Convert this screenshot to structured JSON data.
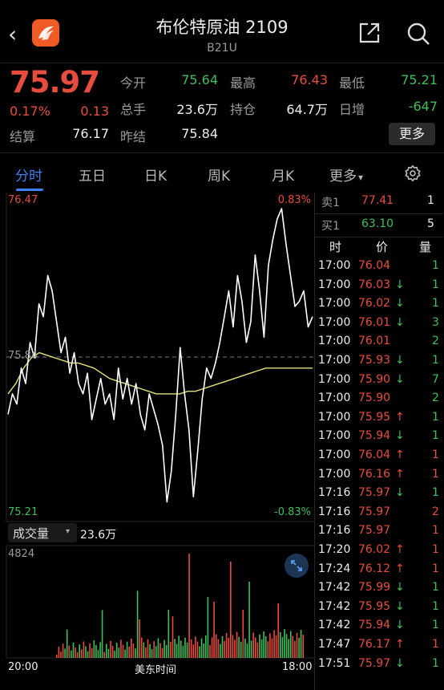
{
  "header": {
    "back_label": "‹",
    "title": "布伦特原油 2109",
    "subtitle": "B21U",
    "icons": [
      "back-icon",
      "app-logo-icon",
      "share-icon",
      "search-icon"
    ]
  },
  "quote": {
    "last_price": "75.97",
    "change_pct": "0.17%",
    "change": "0.13",
    "settlement_label": "结算",
    "settlement": "76.17",
    "stats": [
      {
        "label": "今开",
        "value": "75.64",
        "color": "green"
      },
      {
        "label": "最高",
        "value": "76.43",
        "color": "red"
      },
      {
        "label": "最低",
        "value": "75.21",
        "color": "green"
      },
      {
        "label": "总手",
        "value": "23.6万",
        "color": "white"
      },
      {
        "label": "持仓",
        "value": "64.7万",
        "color": "white"
      },
      {
        "label": "日增",
        "value": "-647",
        "color": "green"
      },
      {
        "label": "昨结",
        "value": "75.84",
        "color": "white"
      }
    ],
    "more_button": "更多"
  },
  "tabs": {
    "items": [
      "分时",
      "五日",
      "日K",
      "周K",
      "月K",
      "更多"
    ],
    "active": "分时",
    "more_caret": "▾",
    "settings_icon": "gear-icon"
  },
  "chart": {
    "top_price": "76.47",
    "top_pct": "0.83%",
    "mid_price": "75.84",
    "bottom_price": "75.21",
    "bottom_pct": "-0.83%",
    "volume_selector": "成交量",
    "volume_caret": "▾",
    "volume_total": "23.6万",
    "volume_max": "4824",
    "time_start": "20:00",
    "time_mid": "美东时间",
    "time_end": "18:00",
    "colors": {
      "up": "#e84c3d",
      "down": "#3fbf5a",
      "price_line": "#ffffff",
      "avg_line": "#e6e07a"
    }
  },
  "chart_data": {
    "type": "line",
    "price_series": [
      75.62,
      75.7,
      75.66,
      75.8,
      75.74,
      75.9,
      75.84,
      76.05,
      76.0,
      76.16,
      76.1,
      75.98,
      75.86,
      75.92,
      75.78,
      75.86,
      75.74,
      75.7,
      75.78,
      75.6,
      75.68,
      75.76,
      75.66,
      75.7,
      75.6,
      75.8,
      75.68,
      75.76,
      75.66,
      75.74,
      75.62,
      75.56,
      75.7,
      75.64,
      75.58,
      75.5,
      75.28,
      75.4,
      75.62,
      75.88,
      75.7,
      75.56,
      75.3,
      75.48,
      75.68,
      75.8,
      75.76,
      75.82,
      75.9,
      76.0,
      76.1,
      75.96,
      76.16,
      76.06,
      75.9,
      75.98,
      76.24,
      76.1,
      75.92,
      76.2,
      76.3,
      76.38,
      76.42,
      76.28,
      76.16,
      76.04,
      76.06,
      76.1,
      75.96,
      76.0
    ],
    "avg_series": [
      75.7,
      75.74,
      75.8,
      75.84,
      75.86,
      75.85,
      75.84,
      75.83,
      75.82,
      75.82,
      75.81,
      75.8,
      75.78,
      75.76,
      75.75,
      75.74,
      75.73,
      75.72,
      75.71,
      75.7,
      75.7,
      75.7,
      75.7,
      75.71,
      75.71,
      75.72,
      75.73,
      75.74,
      75.75,
      75.76,
      75.77,
      75.78,
      75.79,
      75.8,
      75.8,
      75.8,
      75.8,
      75.8,
      75.8,
      75.8
    ],
    "ylim": [
      75.21,
      76.47
    ],
    "reference": 75.84,
    "volume_max": 4824,
    "x_start": "20:00",
    "x_end": "18:00"
  },
  "right_panel": {
    "ask": {
      "label": "卖1",
      "price": "77.41",
      "qty": "1"
    },
    "bid": {
      "label": "买1",
      "price": "63.10",
      "qty": "5"
    },
    "headers": [
      "时",
      "价",
      "量"
    ],
    "ticks": [
      {
        "time": "17:00",
        "price": "76.04",
        "arrow": "",
        "qty": "1",
        "color": "red",
        "qcolor": "green"
      },
      {
        "time": "17:00",
        "price": "76.03",
        "arrow": "↓",
        "qty": "1",
        "color": "red",
        "qcolor": "green"
      },
      {
        "time": "17:00",
        "price": "76.02",
        "arrow": "↓",
        "qty": "1",
        "color": "red",
        "qcolor": "green"
      },
      {
        "time": "17:00",
        "price": "76.01",
        "arrow": "↓",
        "qty": "3",
        "color": "red",
        "qcolor": "green"
      },
      {
        "time": "17:00",
        "price": "76.01",
        "arrow": "",
        "qty": "2",
        "color": "red",
        "qcolor": "green"
      },
      {
        "time": "17:00",
        "price": "75.93",
        "arrow": "↓",
        "qty": "1",
        "color": "red",
        "qcolor": "green"
      },
      {
        "time": "17:00",
        "price": "75.90",
        "arrow": "↓",
        "qty": "7",
        "color": "red",
        "qcolor": "green"
      },
      {
        "time": "17:00",
        "price": "75.90",
        "arrow": "",
        "qty": "2",
        "color": "red",
        "qcolor": "green"
      },
      {
        "time": "17:00",
        "price": "75.95",
        "arrow": "↑",
        "qty": "1",
        "color": "red",
        "qcolor": "green"
      },
      {
        "time": "17:00",
        "price": "75.94",
        "arrow": "↓",
        "qty": "1",
        "color": "red",
        "qcolor": "green"
      },
      {
        "time": "17:00",
        "price": "76.04",
        "arrow": "↑",
        "qty": "1",
        "color": "red",
        "qcolor": "red"
      },
      {
        "time": "17:00",
        "price": "76.16",
        "arrow": "↑",
        "qty": "1",
        "color": "red",
        "qcolor": "red"
      },
      {
        "time": "17:16",
        "price": "75.97",
        "arrow": "↓",
        "qty": "1",
        "color": "red",
        "qcolor": "green"
      },
      {
        "time": "17:16",
        "price": "75.97",
        "arrow": "",
        "qty": "2",
        "color": "red",
        "qcolor": "red"
      },
      {
        "time": "17:16",
        "price": "75.97",
        "arrow": "",
        "qty": "1",
        "color": "red",
        "qcolor": "red"
      },
      {
        "time": "17:20",
        "price": "76.02",
        "arrow": "↑",
        "qty": "1",
        "color": "red",
        "qcolor": "red"
      },
      {
        "time": "17:24",
        "price": "76.12",
        "arrow": "↑",
        "qty": "1",
        "color": "red",
        "qcolor": "red"
      },
      {
        "time": "17:42",
        "price": "75.99",
        "arrow": "↓",
        "qty": "1",
        "color": "red",
        "qcolor": "green"
      },
      {
        "time": "17:42",
        "price": "75.95",
        "arrow": "↓",
        "qty": "1",
        "color": "red",
        "qcolor": "green"
      },
      {
        "time": "17:42",
        "price": "75.94",
        "arrow": "↓",
        "qty": "1",
        "color": "red",
        "qcolor": "green"
      },
      {
        "time": "17:47",
        "price": "76.17",
        "arrow": "↑",
        "qty": "1",
        "color": "red",
        "qcolor": "red"
      },
      {
        "time": "17:51",
        "price": "75.97",
        "arrow": "↓",
        "qty": "1",
        "color": "red",
        "qcolor": "green"
      }
    ]
  }
}
